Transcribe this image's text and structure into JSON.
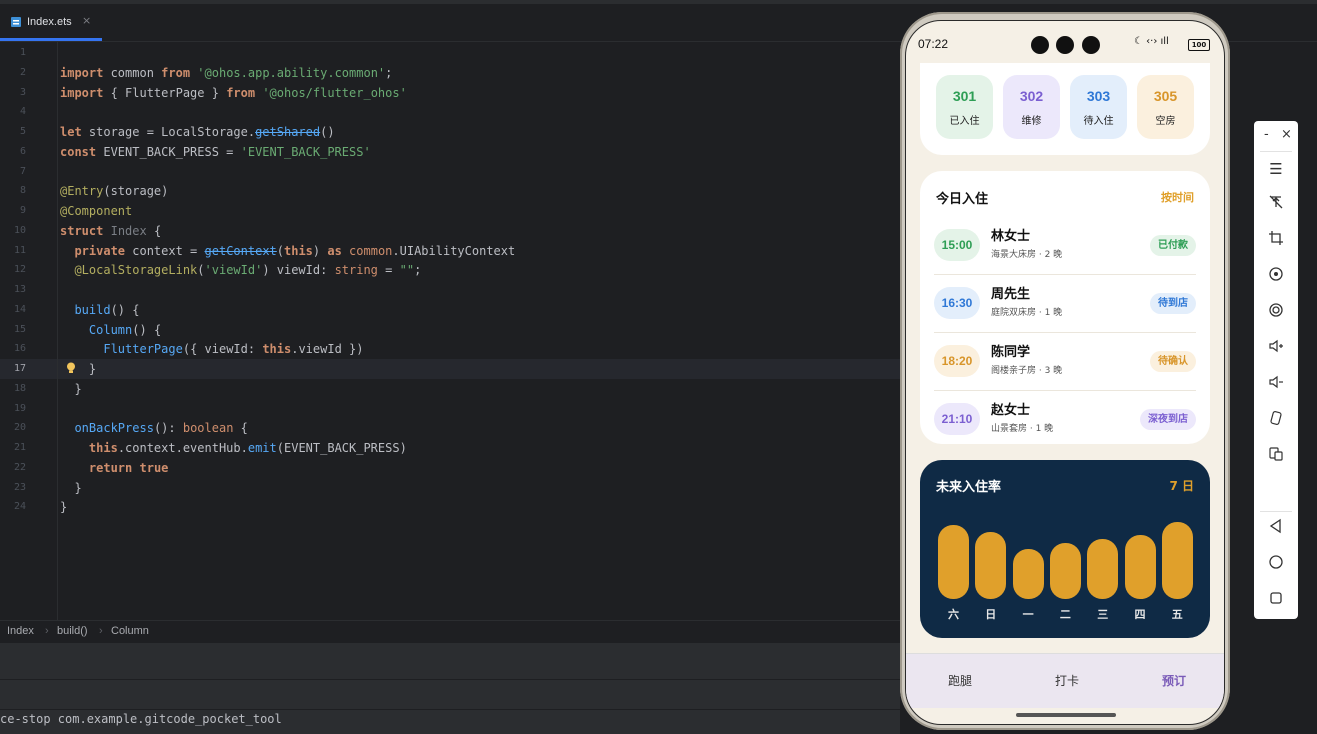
{
  "ide": {
    "tab": {
      "label": "Index.ets",
      "close": "×"
    },
    "lines": [
      {
        "n": "1",
        "html": ""
      },
      {
        "n": "2",
        "html": "<span class='kw'>import</span> common <span class='kw'>from</span> <span class='str'>'@ohos.app.ability.common'</span>;"
      },
      {
        "n": "3",
        "html": "<span class='kw'>import</span> { FlutterPage } <span class='kw'>from</span> <span class='str'>'@ohos/flutter_ohos'</span>"
      },
      {
        "n": "4",
        "html": ""
      },
      {
        "n": "5",
        "html": "<span class='kw'>let</span> storage = LocalStorage.<span class='strike'>getShared</span>()"
      },
      {
        "n": "6",
        "html": "<span class='kw'>const</span> EVENT_BACK_PRESS = <span class='str'>'EVENT_BACK_PRESS'</span>"
      },
      {
        "n": "7",
        "html": ""
      },
      {
        "n": "8",
        "html": "<span class='ann'>@Entry</span>(storage)"
      },
      {
        "n": "9",
        "html": "<span class='ann'>@Component</span>"
      },
      {
        "n": "10",
        "html": "<span class='kw'>struct</span> <span class='dim'>Index</span> {"
      },
      {
        "n": "11",
        "html": "  <span class='kw'>private</span> context = <span class='strike'>getContext</span>(<span class='kw'>this</span>) <span class='kw'>as</span> <span class='ty'>common</span>.UIAbilityContext"
      },
      {
        "n": "12",
        "html": "  <span class='ann'>@LocalStorageLink</span>(<span class='str'>'viewId'</span>) viewId: <span class='ty'>string</span> = <span class='str'>\"\"</span>;"
      },
      {
        "n": "13",
        "html": ""
      },
      {
        "n": "14",
        "html": "  <span class='fn'>build</span>() {"
      },
      {
        "n": "15",
        "html": "    <span class='fn'>Column</span>() {"
      },
      {
        "n": "16",
        "html": "      <span class='fn'>FlutterPage</span>({ viewId: <span class='kw'>this</span>.viewId })"
      },
      {
        "n": "17",
        "html": "    }"
      },
      {
        "n": "18",
        "html": "  }"
      },
      {
        "n": "19",
        "html": ""
      },
      {
        "n": "20",
        "html": "  <span class='fn'>onBackPress</span>(): <span class='ty'>boolean</span> {"
      },
      {
        "n": "21",
        "html": "    <span class='kw'>this</span>.context.eventHub.<span class='fn'>emit</span>(EVENT_BACK_PRESS)"
      },
      {
        "n": "22",
        "html": "    <span class='kw'>return</span> <span class='kw'>true</span>"
      },
      {
        "n": "23",
        "html": "  }"
      },
      {
        "n": "24",
        "html": "}"
      }
    ],
    "breadcrumb": [
      "Index",
      "build()",
      "Column"
    ],
    "terminal": "ce-stop com.example.gitcode_pocket_tool"
  },
  "phone": {
    "time": "07:22",
    "battery": "100",
    "stats": [
      {
        "num": "301",
        "label": "已入住",
        "color": "#2e9e55",
        "bg": "#e4f3e8"
      },
      {
        "num": "302",
        "label": "维修",
        "color": "#7b5fd1",
        "bg": "#ece8fb"
      },
      {
        "num": "303",
        "label": "待入住",
        "color": "#2f78d6",
        "bg": "#e3eefb"
      },
      {
        "num": "305",
        "label": "空房",
        "color": "#d8952a",
        "bg": "#fbf0de"
      }
    ],
    "checkin": {
      "title": "今日入住",
      "sort": "按时间",
      "rows": [
        {
          "time": "15:00",
          "name": "林女士",
          "detail": "海景大床房 · 2 晚",
          "status": "已付款",
          "tc": "#2e9e55",
          "tbg": "#e4f3e8",
          "sc": "#2e9e55",
          "sbg": "#e4f3e8"
        },
        {
          "time": "16:30",
          "name": "周先生",
          "detail": "庭院双床房 · 1 晚",
          "status": "待到店",
          "tc": "#2f78d6",
          "tbg": "#e3eefb",
          "sc": "#2f78d6",
          "sbg": "#e3eefb"
        },
        {
          "time": "18:20",
          "name": "陈同学",
          "detail": "阁楼亲子房 · 3 晚",
          "status": "待确认",
          "tc": "#d8952a",
          "tbg": "#fbf0de",
          "sc": "#d8952a",
          "sbg": "#fbf0de"
        },
        {
          "time": "21:10",
          "name": "赵女士",
          "detail": "山景套房 · 1 晚",
          "status": "深夜到店",
          "tc": "#7b5fd1",
          "tbg": "#ece8fb",
          "sc": "#7b5fd1",
          "sbg": "#ece8fb"
        }
      ]
    },
    "occupancy": {
      "title": "未来入住率",
      "range": "7 日",
      "bars": [
        {
          "label": "六",
          "value": 0.82
        },
        {
          "label": "日",
          "value": 0.74
        },
        {
          "label": "一",
          "value": 0.56
        },
        {
          "label": "二",
          "value": 0.62
        },
        {
          "label": "三",
          "value": 0.67
        },
        {
          "label": "四",
          "value": 0.71
        },
        {
          "label": "五",
          "value": 0.86
        }
      ]
    },
    "nav": [
      {
        "label": "跑腿",
        "active": false
      },
      {
        "label": "打卡",
        "active": false
      },
      {
        "label": "预订",
        "active": true
      }
    ]
  },
  "emulator_toolbar": {
    "minimize": "-",
    "close": "×",
    "buttons": [
      "menu-icon",
      "pin-off-icon",
      "crop-icon",
      "rotate-icon",
      "screenshot-icon",
      "volume-up-icon",
      "volume-down-icon",
      "fold-icon",
      "multi-screen-icon",
      "back-icon",
      "home-icon",
      "recents-icon"
    ]
  }
}
